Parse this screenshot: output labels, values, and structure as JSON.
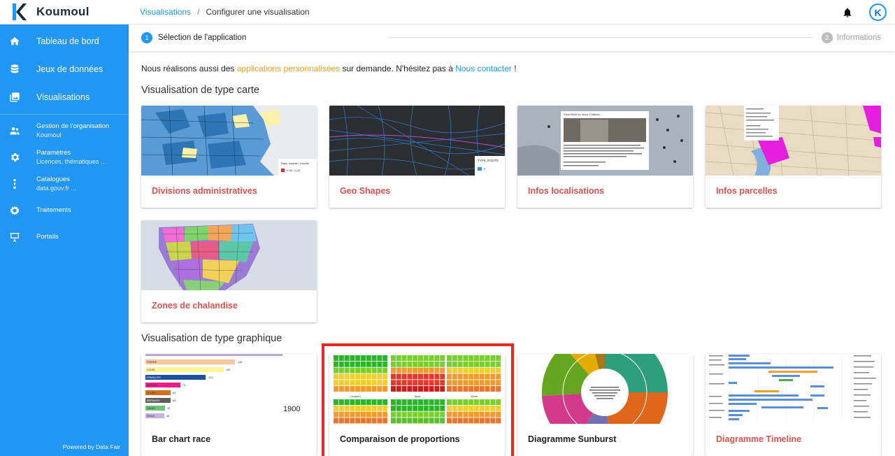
{
  "brand": {
    "name": "Koumoul",
    "brand_color": "#2196f3"
  },
  "nav": {
    "main": [
      {
        "label": "Tableau de bord",
        "icon": "home-icon"
      },
      {
        "label": "Jeux de données",
        "icon": "database-icon"
      },
      {
        "label": "Visualisations",
        "icon": "image-gallery-icon"
      }
    ],
    "sub": [
      {
        "label": "Gestion de l'organisation",
        "sublabel": "Koumoul",
        "icon": "group-icon"
      },
      {
        "label": "Paramètres",
        "sublabel": "Licences, thématiques ...",
        "icon": "gear-icon"
      },
      {
        "label": "Catalogues",
        "sublabel": "data.gouv.fr ...",
        "icon": "vertical-dots-icon"
      },
      {
        "label": "Traitements",
        "sublabel": "",
        "icon": "cog-processing-icon"
      },
      {
        "label": "Portails",
        "sublabel": "",
        "icon": "presentation-board-icon"
      }
    ],
    "powered_by": "Powered by Data Fair"
  },
  "topbar": {
    "breadcrumb_link": "Visualisations",
    "breadcrumb_sep": "/",
    "breadcrumb_current": "Configurer une visualisation",
    "avatar_letter": "K"
  },
  "stepper": {
    "step1_number": "1",
    "step1_label": "Sélection de l'application",
    "step2_number": "2",
    "step2_label": "Informations"
  },
  "intro": {
    "text_before": "Nous réalisons aussi des ",
    "link1": "applications personnalisées",
    "text_middle": " sur demande. N'hésitez pas à ",
    "link2": "Nous contacter",
    "text_after": " !"
  },
  "sections": {
    "map_title": "Visualisation de type carte",
    "chart_title": "Visualisation de type graphique"
  },
  "map_cards": [
    {
      "title": "Divisions administratives",
      "thumb_legend": "Ratio Votants / Inscrits",
      "thumb_legend_value": "0,98 - 0,42"
    },
    {
      "title": "Geo Shapes",
      "thumb_legend": "TYPE_ROUTE",
      "thumb_legend_value": "0"
    },
    {
      "title": "Infos localisations",
      "thumb_popup_title": "Vista Mare du Vieux Château"
    },
    {
      "title": "Infos parcelles"
    },
    {
      "title": "Zones de chalandise"
    }
  ],
  "chart_cards": [
    {
      "title": "Bar chart race",
      "year": "1900",
      "bars": [
        {
          "name": "PIERRE",
          "value": "138"
        },
        {
          "name": "LOUIS",
          "value": "169"
        },
        {
          "name": "FRANÇOIS",
          "value": "123"
        },
        {
          "name": "MARCEL",
          "value": "73"
        },
        {
          "name": "JULIEN",
          "value": "64"
        },
        {
          "name": "BERNARD",
          "value": "64"
        },
        {
          "name": "HENRI",
          "value": "49"
        },
        {
          "name": "ÉMILE",
          "value": "48"
        }
      ]
    },
    {
      "title": "Comparaison de proportions",
      "thumb_labels": [
        "Location",
        "Neuf",
        "Vente"
      ]
    },
    {
      "title": "Diagramme Sunburst"
    },
    {
      "title": "Diagramme Timeline"
    }
  ]
}
